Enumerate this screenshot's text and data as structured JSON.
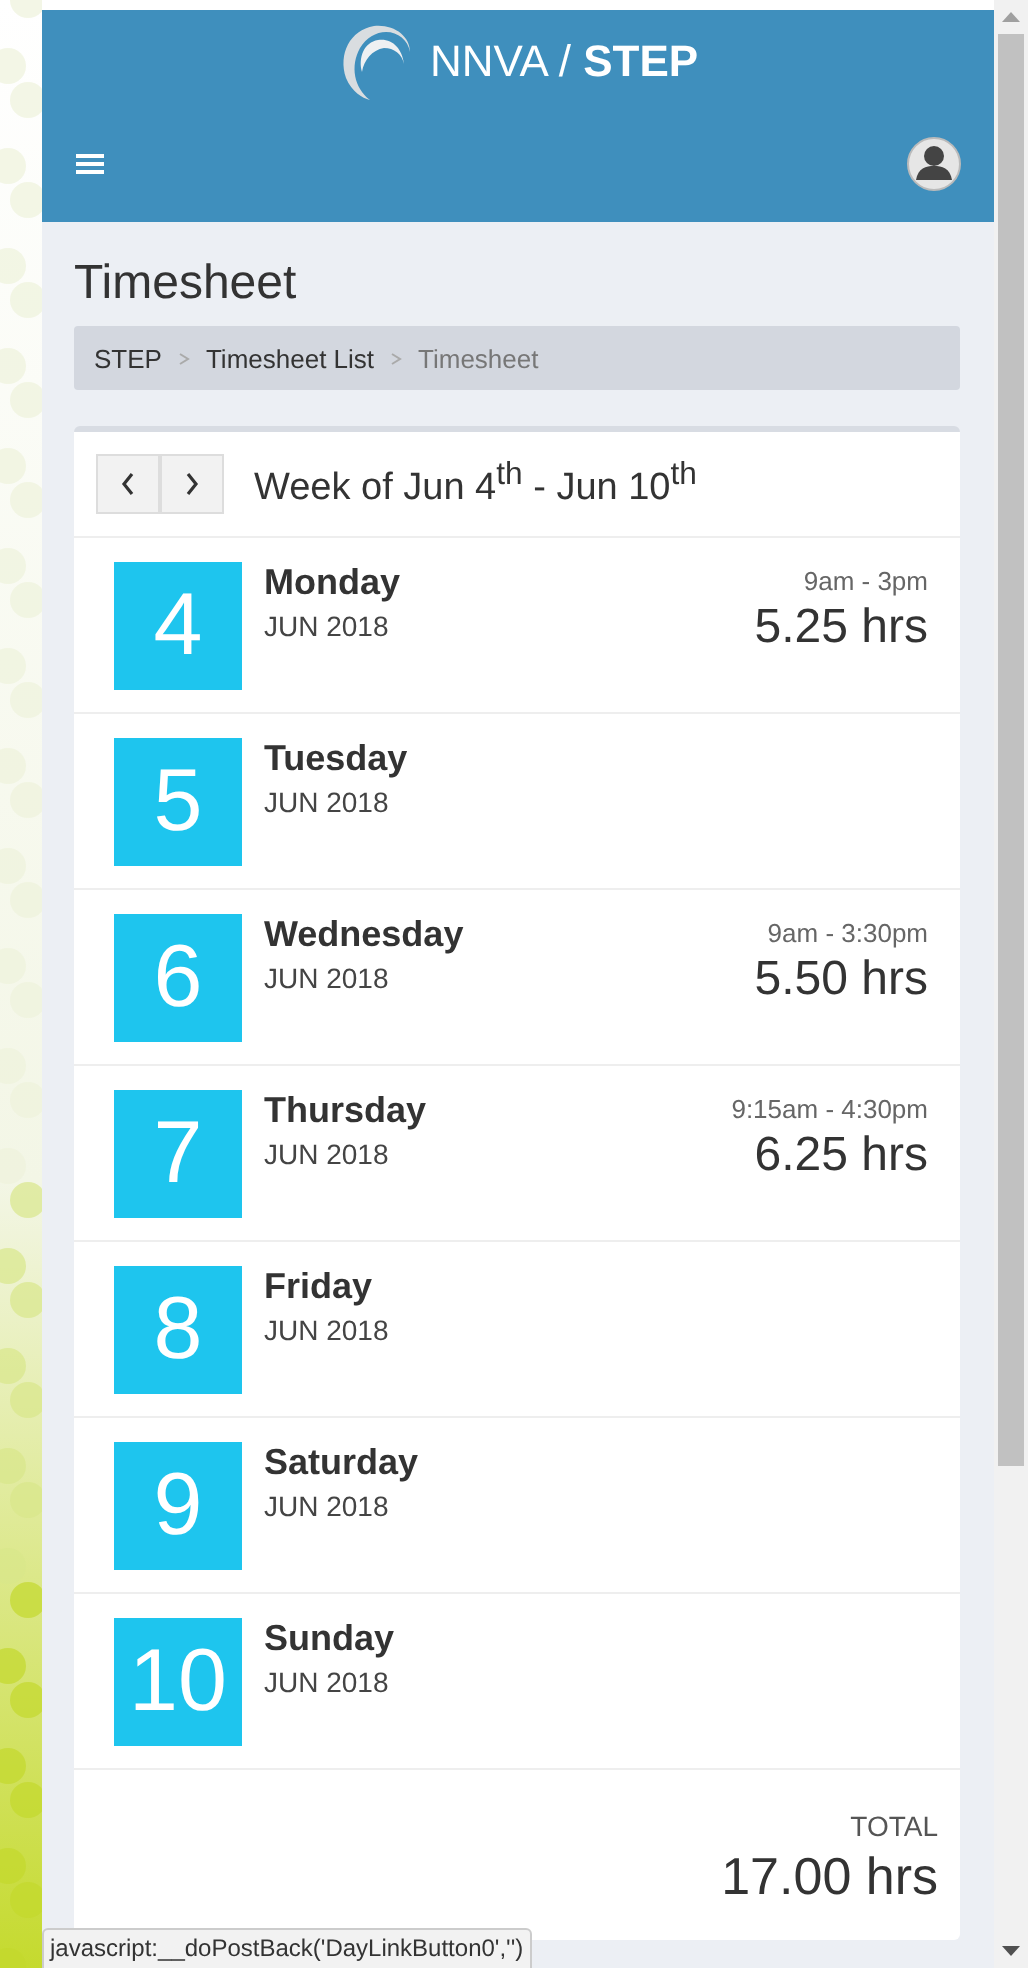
{
  "header": {
    "brand": "NNVA /",
    "brand_strong": "STEP"
  },
  "page_title": "Timesheet",
  "breadcrumb": [
    {
      "label": "STEP",
      "current": false
    },
    {
      "label": "Timesheet List",
      "current": false
    },
    {
      "label": "Timesheet",
      "current": true
    }
  ],
  "week": {
    "label": "Week of Jun 4$^{th}$ - Jun 10$^{th}$"
  },
  "days": [
    {
      "date": "4",
      "name": "Monday",
      "month": "JUN 2018",
      "range": "9am - 3pm",
      "hours": "5.25 hrs"
    },
    {
      "date": "5",
      "name": "Tuesday",
      "month": "JUN 2018"
    },
    {
      "date": "6",
      "name": "Wednesday",
      "month": "JUN 2018",
      "range": "9am - 3:30pm",
      "hours": "5.50 hrs"
    },
    {
      "date": "7",
      "name": "Thursday",
      "month": "JUN 2018",
      "range": "9:15am - 4:30pm",
      "hours": "6.25 hrs"
    },
    {
      "date": "8",
      "name": "Friday",
      "month": "JUN 2018"
    },
    {
      "date": "9",
      "name": "Saturday",
      "month": "JUN 2018"
    },
    {
      "date": "10",
      "name": "Sunday",
      "month": "JUN 2018"
    }
  ],
  "total": {
    "label": "TOTAL",
    "value": "17.00 hrs"
  },
  "status_bar": "javascript:__doPostBack('DayLinkButton0','')"
}
